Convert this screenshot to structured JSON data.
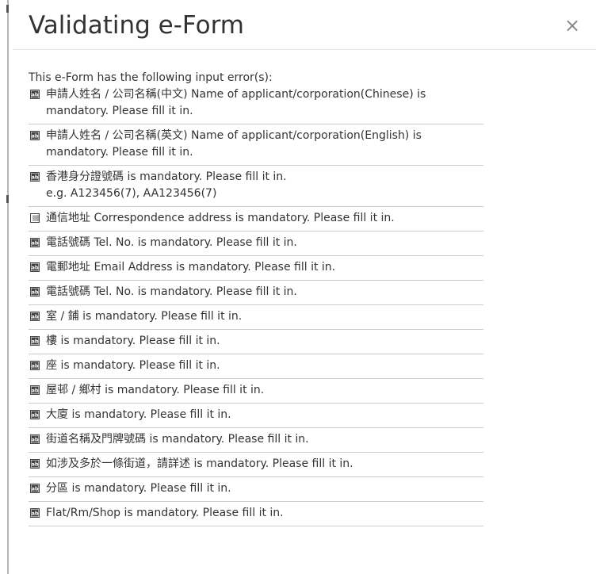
{
  "dialog": {
    "title": "Validating e-Form",
    "close_label": "×",
    "intro": "This e-Form has the following input error(s):"
  },
  "errors": [
    {
      "icon": "text-field-icon",
      "text": "申請人姓名 / 公司名稱(中文) Name of applicant/corporation(Chinese) is mandatory. Please fill it in.",
      "hint": ""
    },
    {
      "icon": "text-field-icon",
      "text": "申請人姓名 / 公司名稱(英文) Name of applicant/corporation(English) is mandatory. Please fill it in.",
      "hint": ""
    },
    {
      "icon": "text-field-icon",
      "text": "香港身分證號碼 is mandatory. Please fill it in.",
      "hint": "e.g. A123456(7), AA123456(7)"
    },
    {
      "icon": "text-area-icon",
      "text": "通信地址 Correspondence address is mandatory. Please fill it in.",
      "hint": ""
    },
    {
      "icon": "text-field-icon",
      "text": "電話號碼 Tel. No. is mandatory. Please fill it in.",
      "hint": ""
    },
    {
      "icon": "text-field-icon",
      "text": "電郵地址 Email Address is mandatory. Please fill it in.",
      "hint": ""
    },
    {
      "icon": "text-field-icon",
      "text": "電話號碼 Tel. No. is mandatory. Please fill it in.",
      "hint": ""
    },
    {
      "icon": "text-field-icon",
      "text": "室 / 鋪 is mandatory. Please fill it in.",
      "hint": ""
    },
    {
      "icon": "text-field-icon",
      "text": "樓 is mandatory. Please fill it in.",
      "hint": ""
    },
    {
      "icon": "text-field-icon",
      "text": "座 is mandatory. Please fill it in.",
      "hint": ""
    },
    {
      "icon": "text-field-icon",
      "text": "屋邨 / 鄉村 is mandatory. Please fill it in.",
      "hint": ""
    },
    {
      "icon": "text-field-icon",
      "text": "大廈 is mandatory. Please fill it in.",
      "hint": ""
    },
    {
      "icon": "text-field-icon",
      "text": "街道名稱及門牌號碼 is mandatory. Please fill it in.",
      "hint": ""
    },
    {
      "icon": "text-field-icon",
      "text": "如涉及多於一條街道，請詳述 is mandatory. Please fill it in.",
      "hint": ""
    },
    {
      "icon": "text-field-icon",
      "text": "分區 is mandatory. Please fill it in.",
      "hint": ""
    },
    {
      "icon": "text-field-icon",
      "text": "Flat/Rm/Shop is mandatory. Please fill it in.",
      "hint": ""
    }
  ]
}
